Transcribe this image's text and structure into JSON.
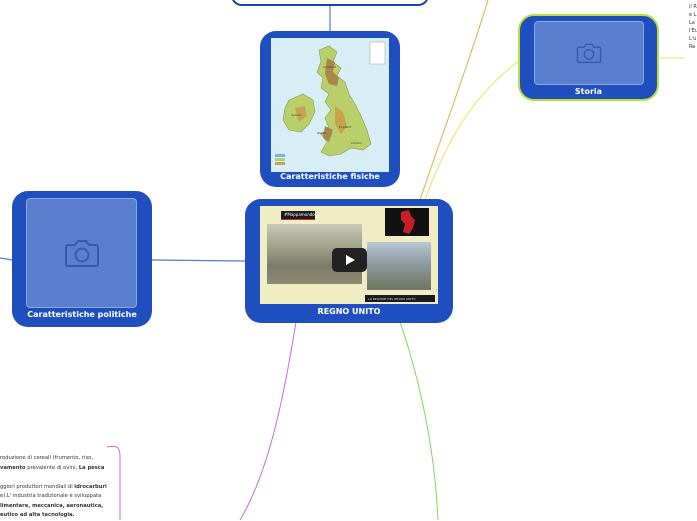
{
  "mindmap": {
    "central": {
      "label": "REGNO UNITO",
      "video_overlay": "#Mappamondo",
      "video_caption": "LA REGIONE DEL REGNO UNITO"
    },
    "nodes": [
      {
        "id": "fisiche",
        "label": "Caratteristiche fisiche"
      },
      {
        "id": "politiche",
        "label": "Caratteristiche politiche"
      },
      {
        "id": "storia",
        "label": "Storia"
      }
    ],
    "economy_note": {
      "line1": "roduzione di cereali (frumento, riso,",
      "line2_bold": "vamento",
      "line2_rest": " prevalente di ovini, ",
      "line2_bold2": "La pesca",
      "line3": "",
      "line4_pre": "ggiori produttori mondiali di ",
      "line4_bold": "idrocarburi",
      "line5": "e).L' industria tradizionale è sviluppata",
      "line6": "limentare, meccanica, aeronautica,",
      "line7": "eutico ad alta tecnologia."
    },
    "storia_note": [
      "il R",
      "e L",
      "La",
      "l'Eu",
      "L'u",
      "Re"
    ],
    "map_labels": [
      "Scotland",
      "England",
      "Wales",
      "Ireland",
      "London"
    ]
  },
  "colors": {
    "node_fill": "#1f4fbf",
    "node_border": "#1a44ad",
    "storia_border": "#b7e23a",
    "placeholder": "#5b7fcf",
    "line_blue": "#4a7fd4",
    "line_orange": "#f4a640",
    "line_yellow": "#e8e35a",
    "line_green": "#7ed957",
    "line_purple": "#c86bd6"
  },
  "icons": [
    "camera-icon",
    "play-icon"
  ]
}
